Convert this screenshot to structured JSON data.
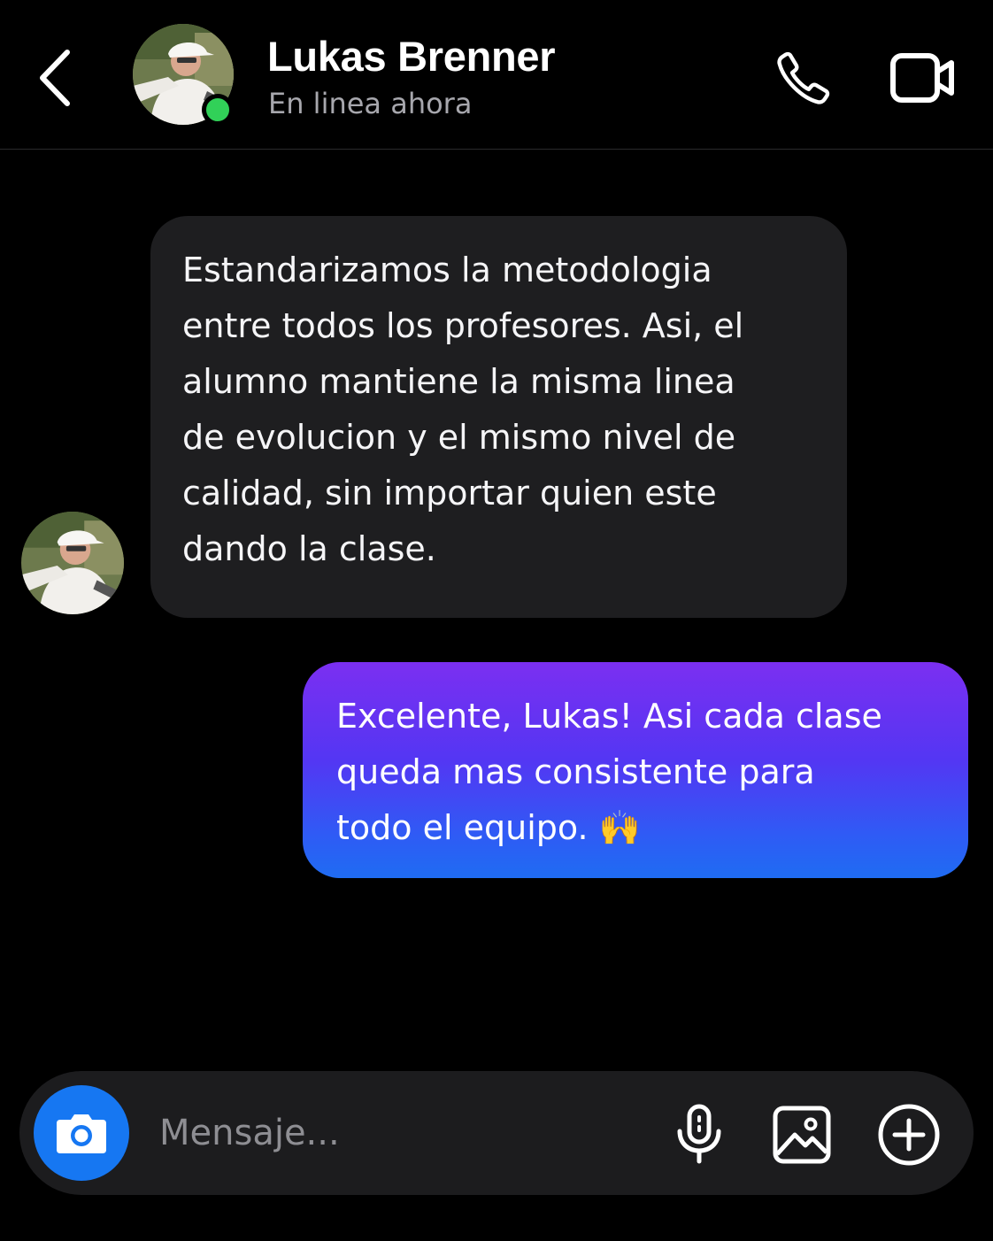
{
  "header": {
    "contact_name": "Lukas Brenner",
    "status": "En linea ahora",
    "back_icon": "chevron-left-icon",
    "call_icon": "phone-icon",
    "video_icon": "video-camera-icon"
  },
  "messages": [
    {
      "direction": "incoming",
      "text": "Estandarizamos la metodologia\nentre todos los profesores. Asi, el\nalumno mantiene la misma linea\nde evolucion y el mismo nivel de\ncalidad, sin importar quien este\ndando la clase."
    },
    {
      "direction": "outgoing",
      "text": "Excelente, Lukas! Asi cada clase\nqueda mas consistente para\ntodo el equipo. 🙌"
    }
  ],
  "composer": {
    "placeholder": "Mensaje...",
    "camera_icon": "camera-icon",
    "mic_icon": "microphone-icon",
    "gallery_icon": "image-icon",
    "plus_icon": "plus-circle-icon"
  },
  "colors": {
    "background": "#000000",
    "incoming_bubble": "#1e1e20",
    "outgoing_gradient_top": "#7b2ff1",
    "outgoing_gradient_bottom": "#1f6cf2",
    "online_dot": "#31d158",
    "camera_button": "#1677f2",
    "status_text": "#a7a7ad"
  }
}
